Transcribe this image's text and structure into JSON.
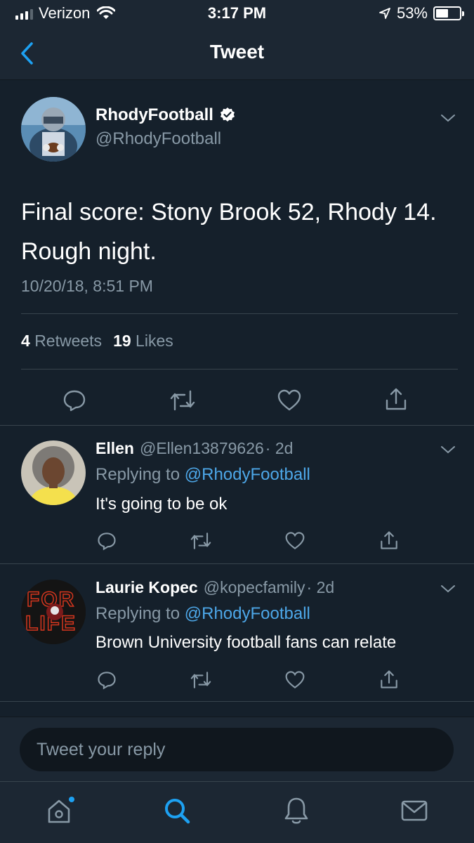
{
  "status_bar": {
    "carrier": "Verizon",
    "time": "3:17 PM",
    "battery_pct": "53%",
    "battery_level": 0.53
  },
  "header": {
    "title": "Tweet"
  },
  "tweet": {
    "author_name": "RhodyFootball",
    "author_handle": "@RhodyFootball",
    "text": "Final score: Stony Brook 52, Rhody 14. Rough night.",
    "timestamp": "10/20/18, 8:51 PM",
    "retweet_count": "4",
    "retweet_label": "Retweets",
    "like_count": "19",
    "like_label": "Likes"
  },
  "replies": [
    {
      "name": "Ellen",
      "handle": "@Ellen13879626",
      "age": "· 2d",
      "replying_prefix": "Replying to",
      "replying_to": "@RhodyFootball",
      "text": "It's going to be ok"
    },
    {
      "name": "Laurie Kopec",
      "handle": "@kopecfamily",
      "age": "· 2d",
      "replying_prefix": "Replying to",
      "replying_to": "@RhodyFootball",
      "text": "Brown University football fans can relate",
      "avatar_text_top": "FOR",
      "avatar_text_bottom": "LIFE"
    }
  ],
  "compose": {
    "placeholder": "Tweet your reply"
  },
  "tabs": [
    "home",
    "search",
    "notifications",
    "messages"
  ],
  "colors": {
    "background": "#15202b",
    "bar": "#1c2733",
    "accent": "#1da1f2",
    "link": "#4da7e8",
    "muted": "#8899a6"
  }
}
